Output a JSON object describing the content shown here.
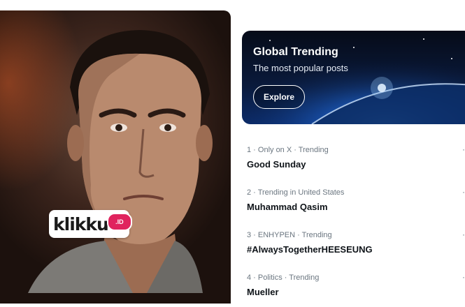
{
  "photo": {
    "watermark": {
      "word": "klikku",
      "badge": ".ID"
    }
  },
  "global_trending": {
    "title": "Global Trending",
    "subtitle": "The most popular posts",
    "explore_label": "Explore"
  },
  "trends": [
    {
      "meta": "1 · Only on X · Trending",
      "name": "Good Sunday"
    },
    {
      "meta": "2 · Trending in United States",
      "name": "Muhammad Qasim"
    },
    {
      "meta": "3 · ENHYPEN · Trending",
      "name": "#AlwaysTogetherHEESEUNG"
    },
    {
      "meta": "4 · Politics · Trending",
      "name": "Mueller"
    }
  ],
  "icons": {
    "more": "more-dots-icon",
    "earth": "earth-glow-image"
  }
}
